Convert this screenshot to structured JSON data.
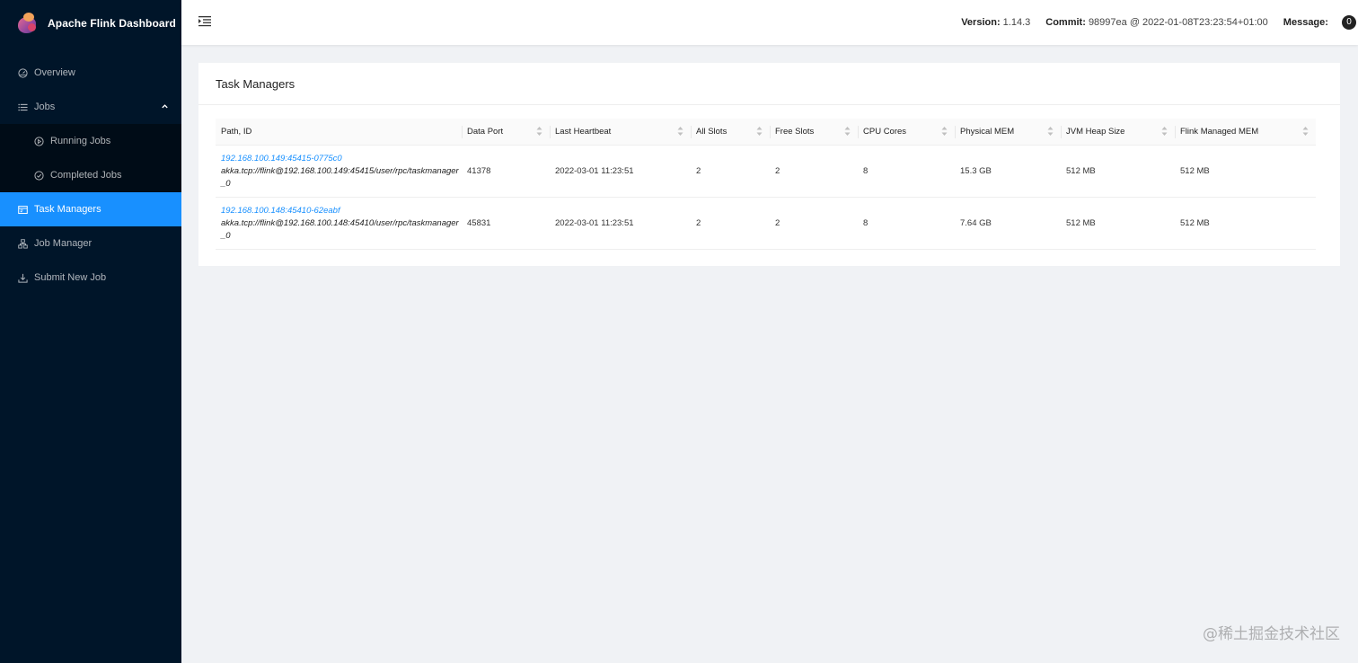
{
  "brand": {
    "title": "Apache Flink Dashboard"
  },
  "sidebar": {
    "items": [
      {
        "label": "Overview",
        "icon": "dashboard-icon"
      },
      {
        "label": "Jobs",
        "icon": "list-icon",
        "expanded": true
      },
      {
        "label": "Running Jobs",
        "icon": "play-circle-icon"
      },
      {
        "label": "Completed Jobs",
        "icon": "check-circle-icon"
      },
      {
        "label": "Task Managers",
        "icon": "schedule-icon",
        "active": true
      },
      {
        "label": "Job Manager",
        "icon": "cluster-icon"
      },
      {
        "label": "Submit New Job",
        "icon": "upload-icon"
      }
    ]
  },
  "header": {
    "version_label": "Version:",
    "version_value": "1.14.3",
    "commit_label": "Commit:",
    "commit_value": "98997ea @ 2022-01-08T23:23:54+01:00",
    "message_label": "Message:",
    "message_count": "0"
  },
  "card": {
    "title": "Task Managers",
    "columns": [
      "Path, ID",
      "Data Port",
      "Last Heartbeat",
      "All Slots",
      "Free Slots",
      "CPU Cores",
      "Physical MEM",
      "JVM Heap Size",
      "Flink Managed MEM"
    ],
    "rows": [
      {
        "id": "192.168.100.149:45415-0775c0",
        "path": "akka.tcp://flink@192.168.100.149:45415/user/rpc/taskmanager_0",
        "data_port": "41378",
        "last_heartbeat": "2022-03-01 11:23:51",
        "all_slots": "2",
        "free_slots": "2",
        "cpu_cores": "8",
        "physical_mem": "15.3 GB",
        "jvm_heap": "512 MB",
        "managed_mem": "512 MB"
      },
      {
        "id": "192.168.100.148:45410-62eabf",
        "path": "akka.tcp://flink@192.168.100.148:45410/user/rpc/taskmanager_0",
        "data_port": "45831",
        "last_heartbeat": "2022-03-01 11:23:51",
        "all_slots": "2",
        "free_slots": "2",
        "cpu_cores": "8",
        "physical_mem": "7.64 GB",
        "jvm_heap": "512 MB",
        "managed_mem": "512 MB"
      }
    ]
  },
  "watermark": "@稀土掘金技术社区"
}
